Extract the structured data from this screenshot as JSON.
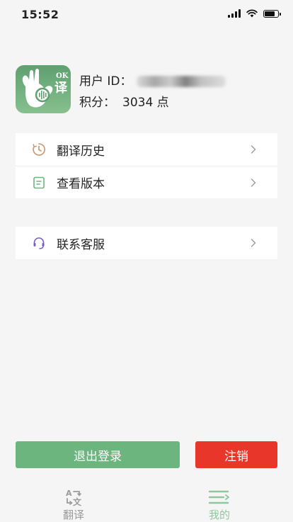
{
  "status_bar": {
    "time": "15:52",
    "icons": [
      "signal-icon",
      "wifi-icon",
      "battery-icon"
    ]
  },
  "profile": {
    "logo_text_top": "OK",
    "logo_text_char": "译",
    "user_id_label": "用户 ID：",
    "points_label": "积分：",
    "points_value": "3034 点"
  },
  "menu": {
    "history_label": "翻译历史",
    "version_label": "查看版本",
    "support_label": "联系客服",
    "icons": [
      "clock-icon",
      "document-icon",
      "headset-icon",
      "chevron-right-icon"
    ]
  },
  "buttons": {
    "logout_label": "退出登录",
    "cancel_account_label": "注销"
  },
  "tabbar": {
    "translate_label": "翻译",
    "mine_label": "我的",
    "active_tab": "我的"
  },
  "colors": {
    "brand_green": "#6cb57e",
    "danger_red": "#e8362a",
    "tab_active": "#8fc79f",
    "tab_inactive": "#9a9a9a",
    "page_bg": "#f5f5f5"
  }
}
